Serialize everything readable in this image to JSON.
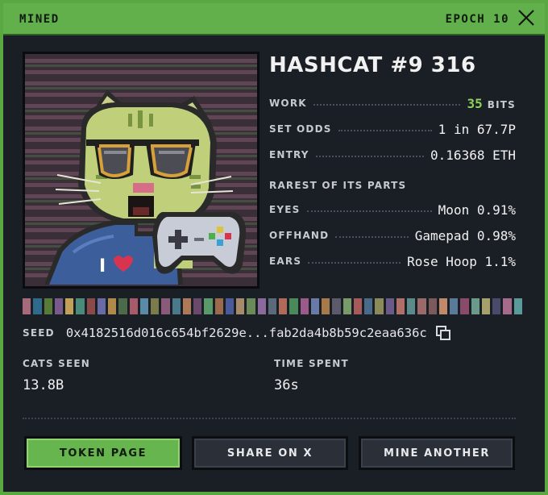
{
  "titlebar": {
    "status": "MINED",
    "epoch": "EPOCH 10"
  },
  "cat": {
    "name": "HASHCAT #9 316"
  },
  "stats": {
    "work_label": "WORK",
    "work_value": "35",
    "work_unit": "BITS",
    "odds_label": "SET ODDS",
    "odds_value": "1 in 67.7P",
    "entry_label": "ENTRY",
    "entry_value": "0.16368 ETH"
  },
  "rarest": {
    "title": "RAREST OF ITS PARTS",
    "items": [
      {
        "label": "EYES",
        "value": "Moon 0.91%"
      },
      {
        "label": "OFFHAND",
        "value": "Gamepad 0.98%"
      },
      {
        "label": "EARS",
        "value": "Rose Hoop 1.1%"
      }
    ]
  },
  "palette": [
    "#a66a7a",
    "#2f6a8a",
    "#5a7a3a",
    "#7a5a8a",
    "#c1a05a",
    "#4a8a7a",
    "#8a4a4a",
    "#6a6aa6",
    "#b08a4a",
    "#4a6a4a",
    "#a65a6a",
    "#5a8aa6",
    "#7a7a4a",
    "#8a5a7a",
    "#4a7a8a",
    "#b07a5a",
    "#6a4a6a",
    "#5a9a6a",
    "#9a6a4a",
    "#4a5a9a",
    "#a68a6a",
    "#6a8a5a",
    "#8a6a9a",
    "#5a6a7a",
    "#b06a5a",
    "#4a8a5a",
    "#9a5a8a",
    "#6a7aa6",
    "#a67a4a",
    "#5a5a6a",
    "#7a9a6a",
    "#a65a5a",
    "#4a6a8a",
    "#8a8a5a",
    "#6a5a8a",
    "#b0706a",
    "#5a8a8a",
    "#9a6a6a",
    "#7a5a5a",
    "#c08a6a",
    "#5a7a9a",
    "#8a4a6a",
    "#6a9a8a",
    "#a6a06a",
    "#4a4a6a",
    "#a66a8a",
    "#5a9a9a"
  ],
  "seed": {
    "label": "SEED",
    "value": "0x4182516d016c654bf2629e...fab2da4b8b59c2eaa636c"
  },
  "summary": {
    "cats_seen_label": "CATS SEEN",
    "cats_seen_value": "13.8B",
    "time_spent_label": "TIME SPENT",
    "time_spent_value": "36s"
  },
  "buttons": {
    "token_page": "TOKEN PAGE",
    "share": "SHARE ON X",
    "mine_another": "MINE ANOTHER"
  },
  "portrait": {
    "shirt_text": "I"
  },
  "colors": {
    "accent": "#62b04c",
    "work_highlight": "#8fd05b",
    "background": "#1a1e25"
  }
}
